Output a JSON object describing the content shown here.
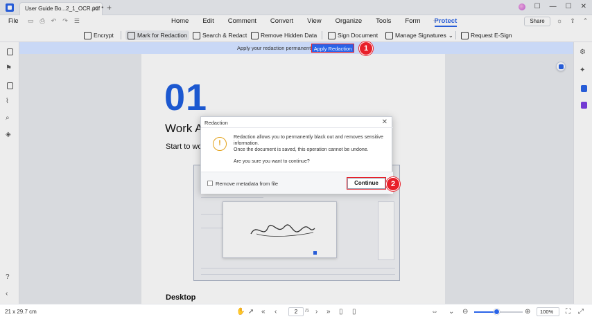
{
  "titlebar": {
    "tab_title": "User Guide Bo...2_1_OCR.pdf *",
    "tab_close": "✕",
    "new_tab": "+",
    "minimize": "—",
    "maximize": "☐",
    "close": "✕"
  },
  "menubar": {
    "file": "File",
    "items": [
      "Home",
      "Edit",
      "Comment",
      "Convert",
      "View",
      "Organize",
      "Tools",
      "Form",
      "Protect"
    ],
    "active": "Protect",
    "share": "Share"
  },
  "toolbar": {
    "encrypt": "Encrypt",
    "mark_for_redaction": "Mark for Redaction",
    "search_redact": "Search & Redact",
    "remove_hidden_data": "Remove Hidden Data",
    "sign_document": "Sign Document",
    "manage_signatures": "Manage Signatures",
    "request_esign": "Request E-Sign"
  },
  "notice": {
    "text": "Apply your redaction permanently.",
    "apply_button": "Apply Redaction",
    "callout": "1"
  },
  "document": {
    "number": "01",
    "heading": "Work A",
    "subheading": "Start to wo",
    "section": "Desktop",
    "signature_text": "Stanton"
  },
  "dialog": {
    "title": "Redaction",
    "warning_glyph": "!",
    "message_line1": "Redaction allows you to permanently black out and removes sensitive",
    "message_line2": "information.",
    "message_line3": "Once the document is saved, this operation cannot be undone.",
    "question": "Are you sure you want to continue?",
    "checkbox_label": "Remove metadata from file",
    "checkbox_checked": false,
    "continue_button": "Continue",
    "callout": "2"
  },
  "statusbar": {
    "page_size": "21 x 29.7 cm",
    "current_page": "2",
    "total_pages": "/5",
    "zoom": "100%",
    "zoom_fraction": 0.45
  },
  "colors": {
    "accent": "#2a63e8",
    "callout": "#e8202a",
    "notice_bg": "#c9d8f6",
    "warning": "#e3a21a"
  }
}
